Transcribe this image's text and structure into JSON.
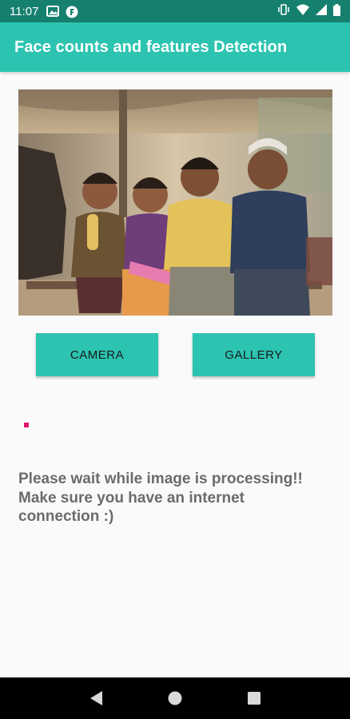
{
  "status_bar": {
    "time": "11:07",
    "left_icons": [
      "image-notification-icon",
      "app-notification-icon"
    ],
    "right_icons": [
      "vibrate-icon",
      "wifi-icon",
      "signal-icon",
      "battery-icon"
    ]
  },
  "app_bar": {
    "title": "Face counts and features Detection",
    "color": "#2cc4b1"
  },
  "photo": {
    "description_icon": "photo-of-children"
  },
  "buttons": {
    "camera_label": "CAMERA",
    "gallery_label": "GALLERY"
  },
  "progress": {
    "color": "#e0136d"
  },
  "message": {
    "line1": "Please wait while image is processing!!",
    "line2": "Make sure you have an internet",
    "line3": "connection :)"
  },
  "nav_bar": {
    "items": [
      "back-icon",
      "home-icon",
      "recents-icon"
    ]
  }
}
